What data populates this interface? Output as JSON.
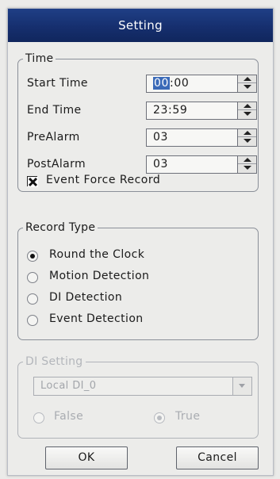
{
  "window": {
    "title": "Setting"
  },
  "time": {
    "legend": "Time",
    "start_time": {
      "label": "Start Time",
      "hour": "00",
      "minute": "00"
    },
    "end_time": {
      "label": "End Time",
      "value": "23:59"
    },
    "prealarm": {
      "label": "PreAlarm",
      "value": "03"
    },
    "postalarm": {
      "label": "PostAlarm",
      "value": "03"
    },
    "event_force_record": {
      "label": "Event Force Record",
      "checked": true
    }
  },
  "record_type": {
    "legend": "Record Type",
    "options": [
      {
        "label": "Round the Clock",
        "selected": true
      },
      {
        "label": "Motion Detection",
        "selected": false
      },
      {
        "label": "DI Detection",
        "selected": false
      },
      {
        "label": "Event Detection",
        "selected": false
      }
    ]
  },
  "di_setting": {
    "legend": "DI Setting",
    "enabled": false,
    "source": "Local DI_0",
    "false_label": "False",
    "true_label": "True",
    "selected": "True"
  },
  "buttons": {
    "ok": "OK",
    "cancel": "Cancel"
  },
  "colors": {
    "title_bar": "#162f6e",
    "selection": "#3a6ab8"
  }
}
